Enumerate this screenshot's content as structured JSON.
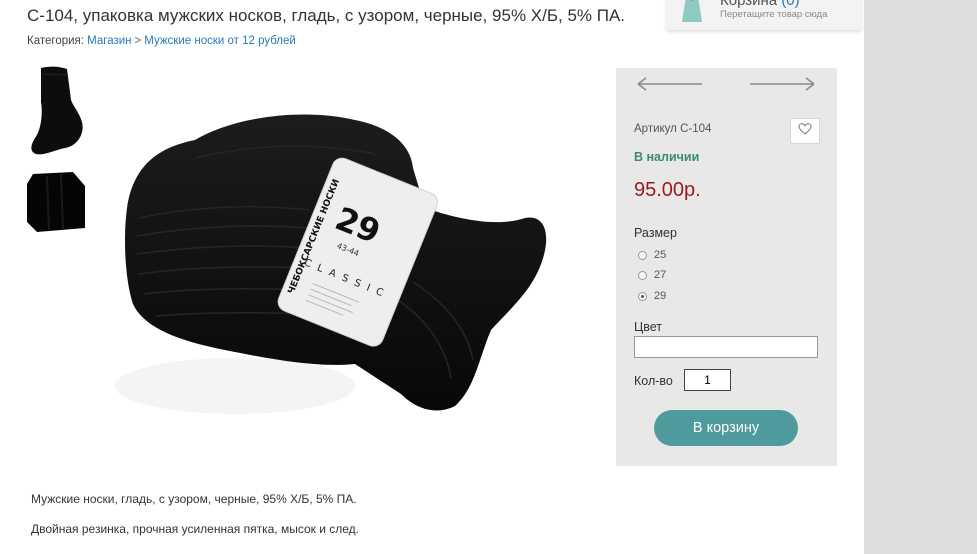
{
  "product": {
    "title": "С-104, упаковка мужских носков, гладь, с узором, черные, 95% Х/Б, 5% ПА."
  },
  "breadcrumb": {
    "prefix": "Категория:",
    "items": [
      "Магазин",
      "Мужские носки от 12 рублей"
    ],
    "separator": ">"
  },
  "cart": {
    "title": "Корзина",
    "count": "(0)",
    "hint": "Перетащите товар сюда"
  },
  "buy_panel": {
    "sku": "Артикул С-104",
    "stock": "В наличии",
    "price": "95.00р.",
    "size_label": "Размер",
    "sizes": [
      {
        "label": "25",
        "checked": false
      },
      {
        "label": "27",
        "checked": false
      },
      {
        "label": "29",
        "checked": true
      }
    ],
    "color_label": "Цвет",
    "color_value": "",
    "qty_label": "Кол-во",
    "qty_value": "1",
    "add_to_cart": "В корзину"
  },
  "package_label": {
    "brand": "ЧЕБОКСАРСКИЕ НОСКИ",
    "size": "29",
    "size_range": "43-44",
    "line": "CLASSIC"
  },
  "description": [
    "Мужские носки, гладь, с узором, черные, 95% Х/Б, 5% ПА.",
    "Двойная резинка, прочная усиленная пятка, мысок и след."
  ],
  "colors": {
    "link": "#2a7ab8",
    "stock": "#3b8a6e",
    "price": "#9b1b1b",
    "button": "#4e9a9c",
    "panel": "#e8e8e8"
  }
}
